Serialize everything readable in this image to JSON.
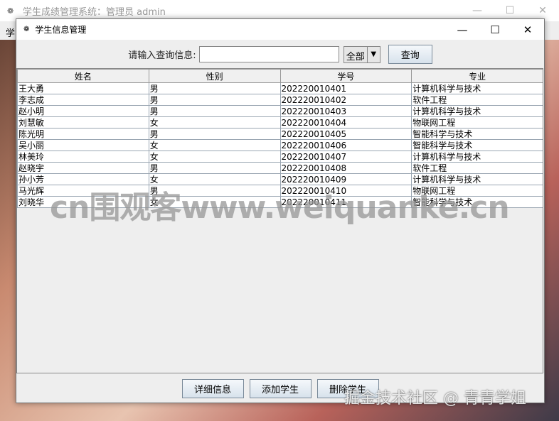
{
  "outer_window": {
    "title": "学生成绩管理系统：管理员 admin",
    "menu_partial": "学"
  },
  "dialog": {
    "title": "学生信息管理"
  },
  "search": {
    "label": "请输入查询信息:",
    "value": "",
    "filter_selected": "全部",
    "query_button": "查询"
  },
  "table": {
    "columns": [
      "姓名",
      "性别",
      "学号",
      "专业"
    ],
    "rows": [
      [
        "王大勇",
        "男",
        "202220010401",
        "计算机科学与技术"
      ],
      [
        "李志成",
        "男",
        "202220010402",
        "软件工程"
      ],
      [
        "赵小明",
        "男",
        "202220010403",
        "计算机科学与技术"
      ],
      [
        "刘慧敏",
        "女",
        "202220010404",
        "物联网工程"
      ],
      [
        "陈光明",
        "男",
        "202220010405",
        "智能科学与技术"
      ],
      [
        "吴小丽",
        "女",
        "202220010406",
        "智能科学与技术"
      ],
      [
        "林美玲",
        "女",
        "202220010407",
        "计算机科学与技术"
      ],
      [
        "赵晓宇",
        "男",
        "202220010408",
        "软件工程"
      ],
      [
        "孙小芳",
        "女",
        "202220010409",
        "计算机科学与技术"
      ],
      [
        "马光辉",
        "男",
        "202220010410",
        "物联网工程"
      ],
      [
        "刘晓华",
        "女",
        "202220010411",
        "智能科学与技术"
      ]
    ]
  },
  "buttons": {
    "details": "详细信息",
    "add": "添加学生",
    "delete": "删除学生"
  },
  "watermarks": {
    "main": "cn围观客www.weiquanke.cn",
    "credit": "掘金技术社区 @ 青青学姐"
  }
}
